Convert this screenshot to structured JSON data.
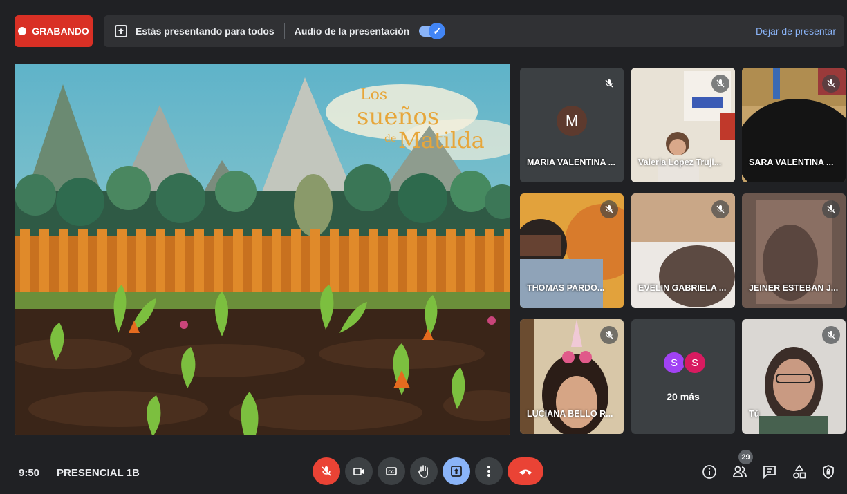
{
  "top_bar": {
    "recording_label": "GRABANDO",
    "presenting_text": "Estás presentando para todos",
    "audio_label": "Audio de la presentación",
    "stop_presenting": "Dejar de presentar"
  },
  "stage": {
    "title_line1": "Los",
    "title_line2": "sueños",
    "title_prefix": "de",
    "title_line3": "Matilda"
  },
  "participants": [
    {
      "name": "MARIA VALENTINA ...",
      "avatar_letter": "M",
      "muted": true
    },
    {
      "name": "Valeria Lopez Truji...",
      "muted": true
    },
    {
      "name": "SARA VALENTINA ...",
      "muted": true
    },
    {
      "name": "THOMAS PARDO...",
      "muted": true
    },
    {
      "name": "EVELIN GABRIELA ...",
      "muted": true
    },
    {
      "name": "JEINER ESTEBAN J...",
      "muted": true
    },
    {
      "name": "LUCIANA BELLO R...",
      "muted": true
    },
    {
      "name": "Tú",
      "muted": true
    }
  ],
  "more_tile": {
    "avatars": [
      "S",
      "S"
    ],
    "avatar_colors": [
      "#a142f4",
      "#d81b60"
    ],
    "label": "20 más"
  },
  "bottom_bar": {
    "time": "9:50",
    "meeting_name": "PRESENCIAL 1B",
    "people_count": "29"
  },
  "colors": {
    "accent": "#8ab4f8",
    "danger": "#ea4335",
    "recording": "#d93025",
    "background": "#202124"
  }
}
